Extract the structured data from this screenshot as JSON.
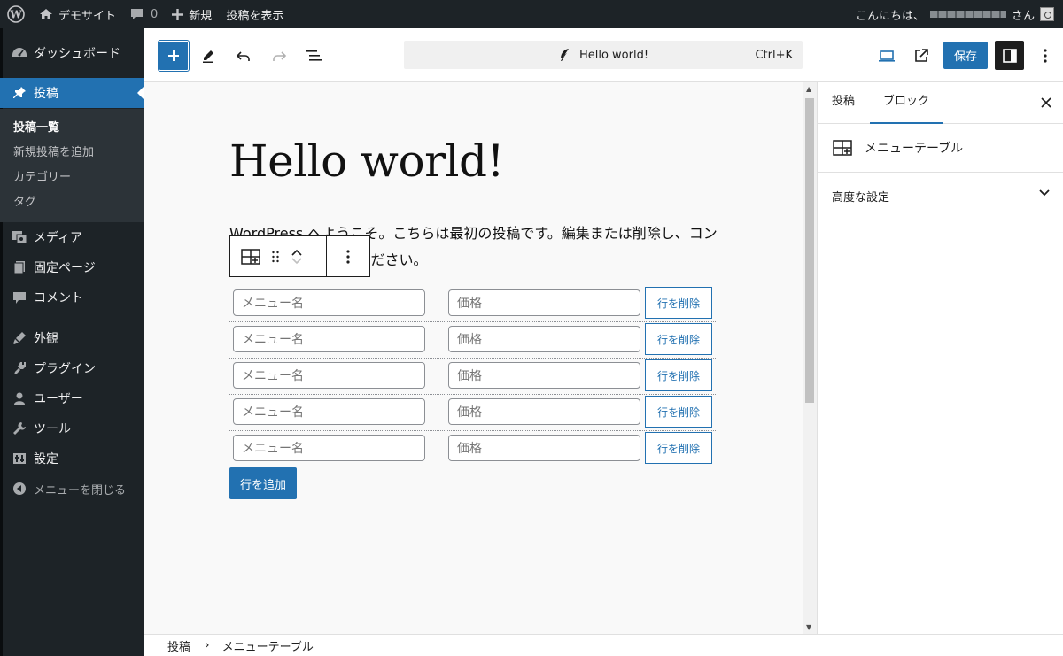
{
  "admin_bar": {
    "site_name": "デモサイト",
    "comments_count": "0",
    "new_label": "新規",
    "view_post_label": "投稿を表示",
    "greeting_prefix": "こんにちは、",
    "greeting_suffix": "さん"
  },
  "admin_menu": {
    "items": [
      {
        "label": "ダッシュボード",
        "icon": "dashboard-icon"
      },
      {
        "label": "投稿",
        "icon": "pushpin-icon"
      },
      {
        "label": "メディア",
        "icon": "media-icon"
      },
      {
        "label": "固定ページ",
        "icon": "pages-icon"
      },
      {
        "label": "コメント",
        "icon": "comment-icon"
      },
      {
        "label": "外観",
        "icon": "appearance-icon"
      },
      {
        "label": "プラグイン",
        "icon": "plugin-icon"
      },
      {
        "label": "ユーザー",
        "icon": "user-icon"
      },
      {
        "label": "ツール",
        "icon": "wrench-icon"
      },
      {
        "label": "設定",
        "icon": "settings-icon"
      },
      {
        "label": "メニューを閉じる",
        "icon": "collapse-icon"
      }
    ],
    "submenu": [
      "投稿一覧",
      "新規投稿を追加",
      "カテゴリー",
      "タグ"
    ]
  },
  "editor_header": {
    "document_title": "Hello world!",
    "shortcut": "Ctrl+K",
    "save_label": "保存"
  },
  "post": {
    "title": "Hello world!",
    "paragraph": "WordPress へようこそ。こちらは最初の投稿です。編集または削除し、コンテンツ作成を始めてください。"
  },
  "menu_table": {
    "rows": [
      {
        "name_placeholder": "メニュー名",
        "price_placeholder": "価格",
        "delete_label": "行を削除"
      },
      {
        "name_placeholder": "メニュー名",
        "price_placeholder": "価格",
        "delete_label": "行を削除"
      },
      {
        "name_placeholder": "メニュー名",
        "price_placeholder": "価格",
        "delete_label": "行を削除"
      },
      {
        "name_placeholder": "メニュー名",
        "price_placeholder": "価格",
        "delete_label": "行を削除"
      },
      {
        "name_placeholder": "メニュー名",
        "price_placeholder": "価格",
        "delete_label": "行を削除"
      }
    ],
    "add_row_label": "行を追加"
  },
  "sidebar": {
    "tabs": [
      "投稿",
      "ブロック"
    ],
    "block_name": "メニューテーブル",
    "advanced_label": "高度な設定"
  },
  "breadcrumb": [
    "投稿",
    "メニューテーブル"
  ],
  "colors": {
    "accent": "#2271b1",
    "admin_bg": "#1d2327",
    "submenu_bg": "#2c3338"
  }
}
